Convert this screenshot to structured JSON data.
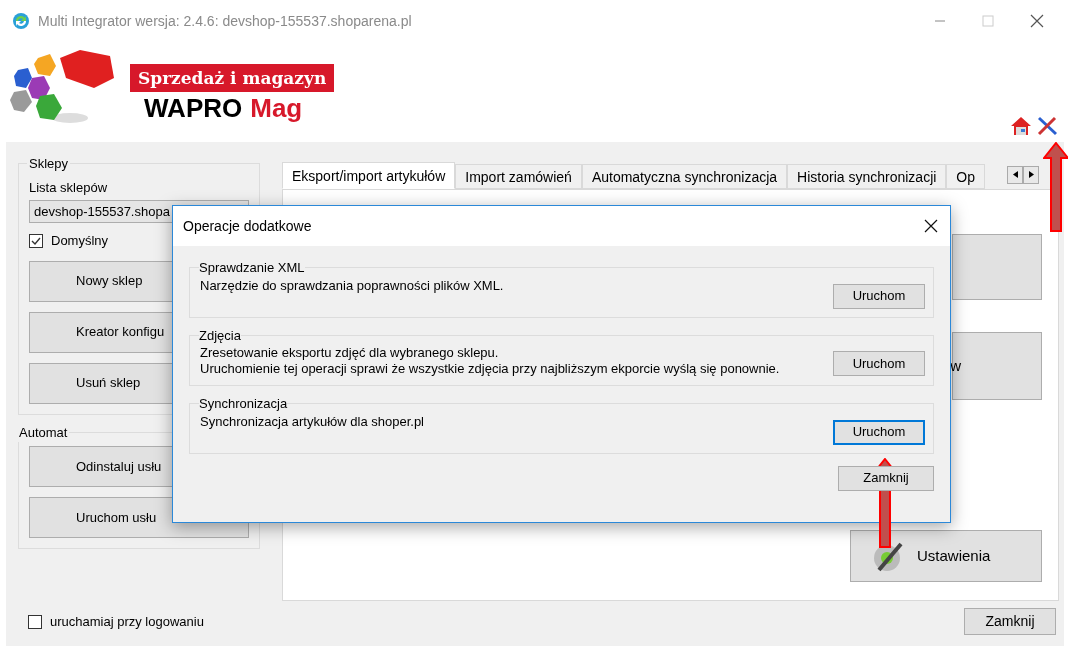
{
  "window": {
    "title": "Multi Integrator wersja: 2.4.6: devshop-155537.shoparena.pl"
  },
  "logo": {
    "tagline": "Sprzedaż i magazyn",
    "brand": "WAPRO",
    "product": "Mag"
  },
  "stores": {
    "title": "Sklepy",
    "list_label": "Lista sklepów",
    "list_value": "devshop-155537.shopa",
    "default_checkbox": {
      "label": "Domyślny",
      "checked": true
    },
    "buttons": [
      "Nowy sklep",
      "Kreator konfigu",
      "Usuń sklep"
    ]
  },
  "automat": {
    "title": "Automat",
    "buttons": [
      "Odinstaluj usłu",
      "Uruchom usłu"
    ]
  },
  "tabs": [
    {
      "label": "Eksport/import artykułów",
      "selected": true
    },
    {
      "label": "Import zamówień",
      "selected": false
    },
    {
      "label": "Automatyczna synchronizacja",
      "selected": false
    },
    {
      "label": "Historia synchronizacji",
      "selected": false
    },
    {
      "label": "Op",
      "selected": false
    }
  ],
  "panel": {
    "partial_button_text": "w",
    "settings_button": "Ustawienia"
  },
  "startup_checkbox": {
    "label": "uruchamiaj przy logowaniu",
    "checked": false
  },
  "close_button": "Zamknij",
  "dialog": {
    "title": "Operacje dodatkowe",
    "sections": [
      {
        "title": "Sprawdzanie XML",
        "lines": [
          "Narzędzie do sprawdzania poprawności plików XML."
        ],
        "button": "Uruchom",
        "focused": false
      },
      {
        "title": "Zdjęcia",
        "lines": [
          "Zresetowanie eksportu zdjęć dla wybranego sklepu.",
          "Uruchomienie tej operacji sprawi że wszystkie zdjęcia przy najbliższym ekporcie wyślą się ponownie."
        ],
        "button": "Uruchom",
        "focused": false
      },
      {
        "title": "Synchronizacja",
        "lines": [
          "Synchronizacja artykułów dla shoper.pl"
        ],
        "button": "Uruchom",
        "focused": true
      }
    ],
    "close_button": "Zamknij"
  }
}
